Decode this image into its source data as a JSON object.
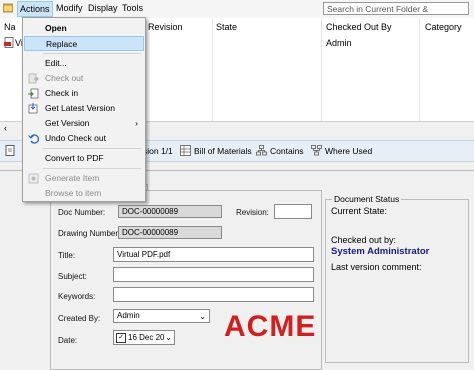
{
  "menubar": {
    "items": [
      "Actions",
      "Modify",
      "Display",
      "Tools"
    ],
    "search_placeholder": "Search in Current Folder & Subfolders"
  },
  "grid": {
    "columns": [
      "Na",
      "Revision",
      "State",
      "Checked Out By",
      "Category"
    ],
    "row_name_fragment": "Vi",
    "row_checked_out_by": "Admin"
  },
  "menu": {
    "items": {
      "open": "Open",
      "replace": "Replace",
      "edit": "Edit...",
      "check_out": "Check out",
      "check_in": "Check in",
      "get_latest_version": "Get Latest Version",
      "get_version": "Get Version",
      "undo_check_out": "Undo Check out",
      "convert_to_pdf": "Convert to PDF",
      "generate_item": "Generate Item",
      "browse_to_item": "Browse to item"
    },
    "submenu_arrow": "›"
  },
  "tabs": {
    "version_fragment": "sion 1/1",
    "bill_of_materials": "Bill of Materials",
    "contains": "Contains",
    "where_used": "Where Used"
  },
  "form": {
    "doc_number_label": "Doc Number:",
    "doc_number": "DOC-00000089",
    "revision_label": "Revision:",
    "revision": "",
    "drawing_number_label": "Drawing Number:",
    "drawing_number": "DOC-00000089",
    "title_label": "Title:",
    "title": "Virtual PDF.pdf",
    "subject_label": "Subject:",
    "subject": "",
    "keywords_label": "Keywords:",
    "keywords": "",
    "created_by_label": "Created By:",
    "created_by": "Admin",
    "date_label": "Date:",
    "date": "16 Dec 20"
  },
  "status": {
    "legend": "Document Status",
    "current_state_label": "Current State:",
    "checked_out_by_label": "Checked out by:",
    "checked_out_by": "System Administrator",
    "last_version_comment_label": "Last version comment:"
  },
  "logo_text": "ACME",
  "colors": {
    "highlight": "#cce4f7",
    "logo": "#d11f1f",
    "status_name": "#1a1a8c"
  }
}
